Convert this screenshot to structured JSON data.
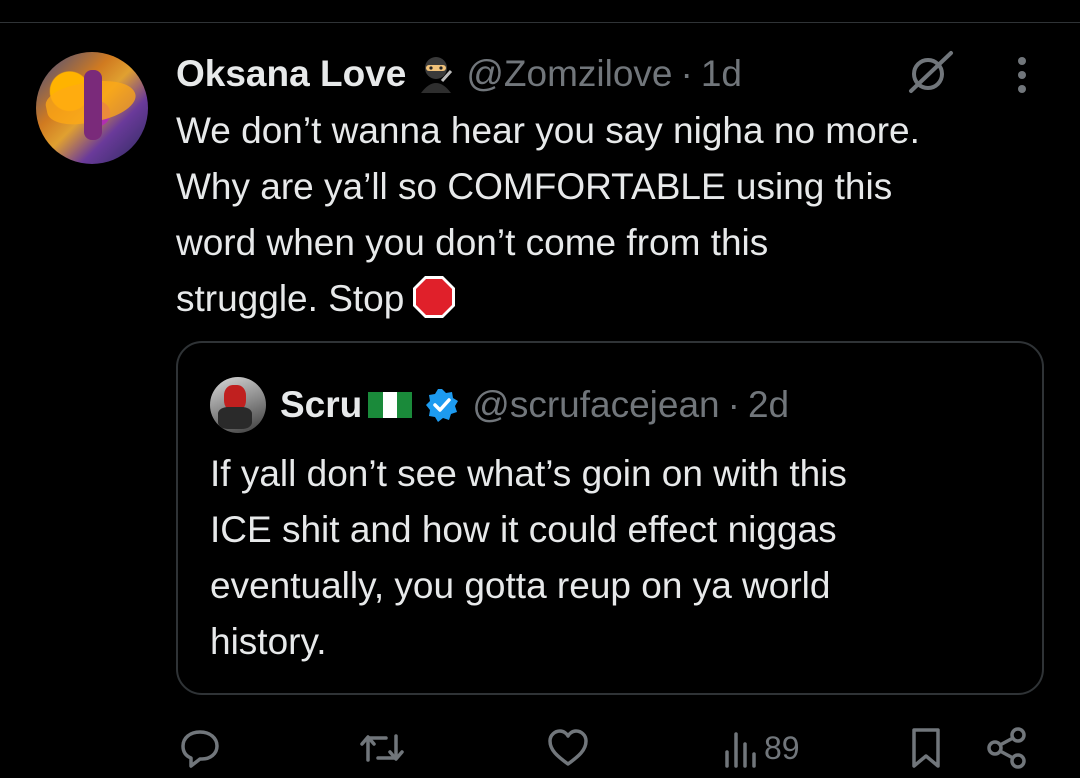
{
  "tweet": {
    "author_name": "Oksana Love",
    "author_emoji": "ninja-emoji",
    "handle": "@Zomzilove",
    "separator": "·",
    "time": "1d",
    "text_lines": [
      "We don’t wanna hear you say nigha no more.",
      "Why are ya’ll so COMFORTABLE using this",
      "word when you don’t come from this",
      "struggle. Stop"
    ],
    "trailing_emoji": "stop-sign-emoji"
  },
  "quoted": {
    "author_name": "Scru",
    "author_flag": "nigeria-flag-emoji",
    "verified": true,
    "handle": "@scrufacejean",
    "separator": "·",
    "time": "2d",
    "text_lines": [
      "If yall don’t see what’s goin on with this",
      "ICE shit and how it could effect niggas",
      "eventually, you gotta reup on ya world",
      "history."
    ]
  },
  "actions": {
    "views": "89",
    "icons": [
      "reply-icon",
      "retweet-icon",
      "like-icon",
      "views-icon",
      "bookmark-icon",
      "share-icon"
    ]
  },
  "colors": {
    "background": "#000000",
    "text": "#e7e9ea",
    "muted": "#71767b",
    "border": "#2f3336",
    "verified": "#1d9bf0"
  }
}
